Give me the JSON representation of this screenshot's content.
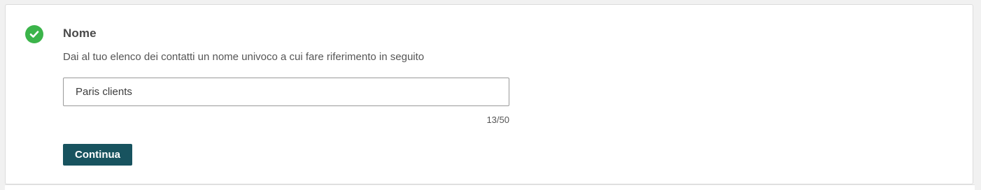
{
  "step": {
    "status_icon": "check-circle-icon",
    "status_color": "#3bb44a",
    "title": "Nome",
    "description": "Dai al tuo elenco dei contatti un nome univoco a cui fare riferimento in seguito"
  },
  "name_field": {
    "value": "Paris clients",
    "counter": "13/50"
  },
  "actions": {
    "continue_label": "Continua",
    "continue_color": "#18535f"
  }
}
